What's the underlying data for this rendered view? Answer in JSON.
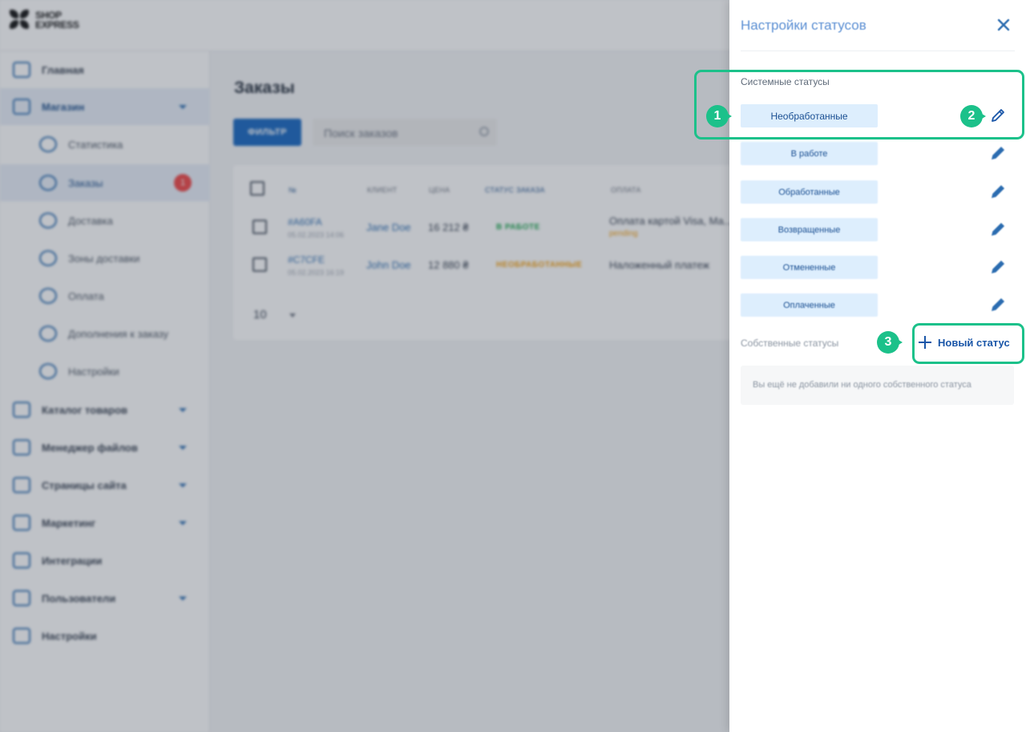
{
  "app": {
    "logo_line1": "SHOP",
    "logo_line2": "EXPRESS"
  },
  "sidebar": {
    "items": [
      {
        "label": "Главная",
        "icon": "home-icon"
      },
      {
        "label": "Магазин",
        "icon": "cart-icon"
      },
      {
        "label": "Статистика",
        "icon": "chart-pie-icon"
      },
      {
        "label": "Заказы",
        "icon": "basket-icon",
        "badge": "1"
      },
      {
        "label": "Доставка",
        "icon": "truck-icon"
      },
      {
        "label": "Зоны доставки",
        "icon": "globe-icon"
      },
      {
        "label": "Оплата",
        "icon": "card-icon"
      },
      {
        "label": "Дополнения к заказу",
        "icon": "plus-circle-icon"
      },
      {
        "label": "Настройки",
        "icon": "gear-icon"
      },
      {
        "label": "Каталог товаров",
        "icon": "book-icon"
      },
      {
        "label": "Менеджер файлов",
        "icon": "folder-icon"
      },
      {
        "label": "Страницы сайта",
        "icon": "pages-icon"
      },
      {
        "label": "Маркетинг",
        "icon": "phone-icon"
      },
      {
        "label": "Интеграции",
        "icon": "megaphone-icon"
      },
      {
        "label": "Пользователи",
        "icon": "user-icon"
      },
      {
        "label": "Настройки",
        "icon": "gear-icon"
      }
    ]
  },
  "orders_page": {
    "title": "Заказы",
    "filter_button": "ФИЛЬТР",
    "search_placeholder": "Поиск заказов",
    "columns": [
      "№",
      "КЛИЕНТ",
      "ЦЕНА",
      "СТАТУС ЗАКАЗА",
      "ОПЛАТА"
    ],
    "rows": [
      {
        "id": "#A60FA",
        "date": "05.02.2023 14:06",
        "client": "Jane Doe",
        "price": "16 212 ₴",
        "status": "В РАБОТЕ",
        "payment": "Оплата картой Visa, Ma...",
        "payment_state": "pending"
      },
      {
        "id": "#C7CFE",
        "date": "05.02.2023 16:19",
        "client": "John Doe",
        "price": "12 880 ₴",
        "status": "НЕОБРАБОТАННЫЕ",
        "payment": "Наложенный платеж",
        "payment_state": ""
      }
    ],
    "page_size": "10"
  },
  "drawer": {
    "title": "Настройки статусов",
    "system_label": "Системные статусы",
    "system_statuses": [
      "Необработанные",
      "В работе",
      "Обработанные",
      "Возвращенные",
      "Отмененные",
      "Оплаченные"
    ],
    "own_label": "Собственные статусы",
    "new_status_button": "Новый статус",
    "empty_text": "Вы ещё не добавили ни одного собственного статуса"
  },
  "annotations": [
    "1",
    "2",
    "3"
  ],
  "colors": {
    "accent": "#1cc18a",
    "primary": "#1565c0",
    "pill_bg": "#ddeefd",
    "link": "#2b6cb0"
  }
}
